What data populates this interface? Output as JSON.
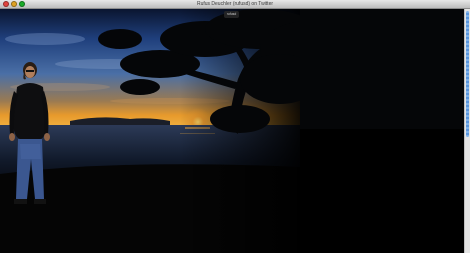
{
  "window": {
    "title": "Rufus Deuchler (rufusd) on Twitter"
  },
  "page": {
    "top_button_label": "rufusd"
  }
}
